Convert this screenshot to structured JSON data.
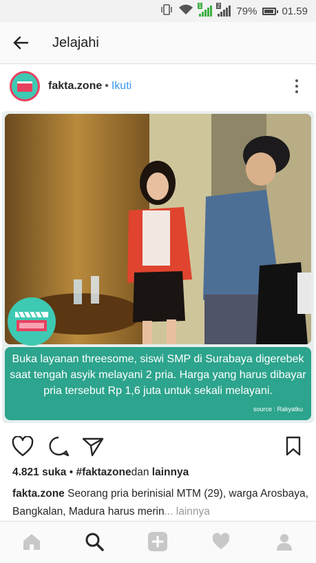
{
  "status_bar": {
    "battery": "79%",
    "time": "01.59",
    "sim1": "1",
    "sim2": "2"
  },
  "app_bar": {
    "title": "Jelajahi"
  },
  "post": {
    "username": "fakta.zone",
    "dot": "•",
    "follow_label": "Ikuti",
    "image_caption": "Buka layanan threesome, siswi SMP di Surabaya digerebek saat tengah asyik melayani 2 pria. Harga yang harus dibayar pria tersebut Rp 1,6 juta untuk sekali melayani.",
    "image_source": "source : Rakyatku",
    "likes_count": "4.821 suka",
    "likes_sep": " • ",
    "likes_tag": "#faktazone",
    "likes_and": "dan ",
    "likes_others": "lainnya",
    "caption_user": "fakta.zone",
    "caption_text": " Seorang pria berinisial MTM (29), warga Arosbaya, Bangkalan, Madura harus merin",
    "caption_ellipsis": "... lainnya"
  },
  "tabs": [
    "home-icon",
    "search-icon",
    "add-icon",
    "heart-icon",
    "profile-icon"
  ],
  "colors": {
    "accent": "#3897f0",
    "teal": "#2da48d",
    "logo": "#3ec9b3",
    "avatar_ring": "#e8415f"
  }
}
